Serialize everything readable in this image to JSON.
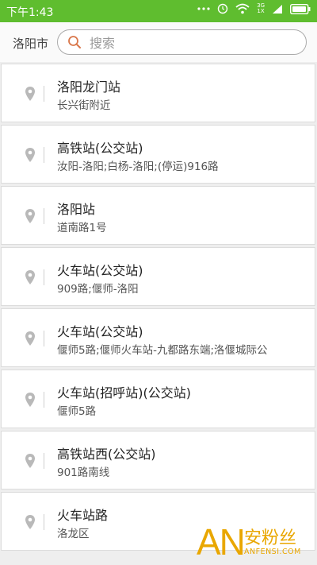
{
  "status_bar": {
    "time": "下午1:43",
    "network_top": "3G",
    "network_bottom": "1X",
    "icons": [
      "dots-icon",
      "alarm-icon",
      "wifi-icon",
      "signal-icon",
      "battery-icon"
    ]
  },
  "search": {
    "city": "洛阳市",
    "placeholder": "搜索",
    "value": ""
  },
  "results": [
    {
      "name": "洛阳龙门站",
      "sub": "长兴街附近"
    },
    {
      "name": "高铁站(公交站)",
      "sub": "汝阳-洛阳;白杨-洛阳;(停运)916路"
    },
    {
      "name": "洛阳站",
      "sub": "道南路1号"
    },
    {
      "name": "火车站(公交站)",
      "sub": "909路;偃师-洛阳"
    },
    {
      "name": "火车站(公交站)",
      "sub": "偃师5路;偃师火车站-九都路东端;洛偃城际公"
    },
    {
      "name": "火车站(招呼站)(公交站)",
      "sub": "偃师5路"
    },
    {
      "name": "高铁站西(公交站)",
      "sub": "901路南线"
    },
    {
      "name": "火车站路",
      "sub": "洛龙区"
    }
  ],
  "watermark": {
    "logo": "AN",
    "name": "安粉丝",
    "domain": "ANFENSI.COM"
  },
  "colors": {
    "status_bar": "#5fbd2f",
    "accent": "#e9a700",
    "search_icon": "#d9774b"
  }
}
